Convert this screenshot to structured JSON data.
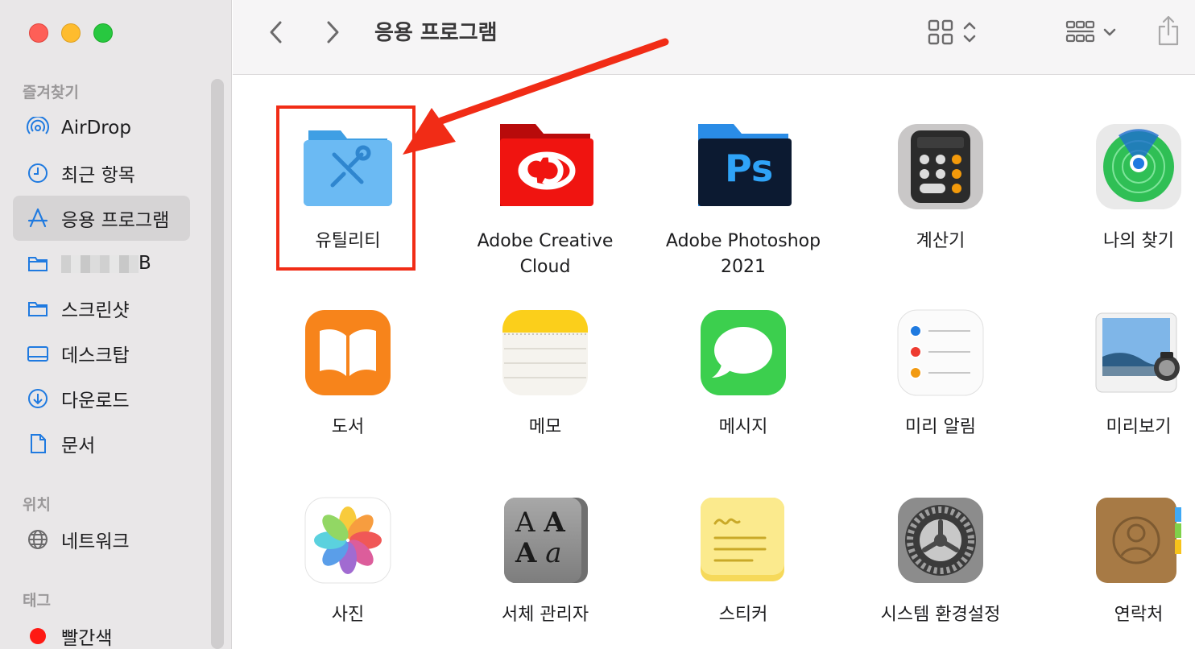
{
  "window": {
    "title": "응용 프로그램"
  },
  "sidebar": {
    "favorites_title": "즐겨찾기",
    "favorites": [
      {
        "label": "AirDrop",
        "icon": "airdrop-icon"
      },
      {
        "label": "최근 항목",
        "icon": "clock-icon"
      },
      {
        "label": "응용 프로그램",
        "icon": "applications-icon",
        "active": true
      },
      {
        "label": "B",
        "icon": "folder-icon",
        "redacted": true
      },
      {
        "label": "스크린샷",
        "icon": "folder-icon"
      },
      {
        "label": "데스크탑",
        "icon": "desktop-icon"
      },
      {
        "label": "다운로드",
        "icon": "download-icon"
      },
      {
        "label": "문서",
        "icon": "document-icon"
      }
    ],
    "locations_title": "위치",
    "locations": [
      {
        "label": "네트워크",
        "icon": "globe-icon"
      }
    ],
    "tags_title": "태그",
    "tags": [
      {
        "label": "빨간색",
        "color": "#fe1a14"
      }
    ]
  },
  "apps": [
    {
      "label": "유틸리티",
      "icon": "utilities-folder-icon"
    },
    {
      "label": "Adobe Creative\nCloud",
      "line1": "Adobe Creative",
      "line2": "Cloud",
      "icon": "creative-cloud-folder-icon"
    },
    {
      "label": "Adobe Photoshop 2021",
      "line1": "Adobe Photoshop",
      "line2": "2021",
      "icon": "photoshop-folder-icon",
      "ps_text": "Ps"
    },
    {
      "label": "계산기",
      "icon": "calculator-icon"
    },
    {
      "label": "나의 찾기",
      "icon": "find-my-icon"
    },
    {
      "label": "도서",
      "icon": "books-icon"
    },
    {
      "label": "메모",
      "icon": "notes-icon"
    },
    {
      "label": "메시지",
      "icon": "messages-icon"
    },
    {
      "label": "미리 알림",
      "icon": "reminders-icon"
    },
    {
      "label": "미리보기",
      "icon": "preview-icon"
    },
    {
      "label": "사진",
      "icon": "photos-icon"
    },
    {
      "label": "서체 관리자",
      "icon": "font-book-icon",
      "glyphs": [
        "A",
        "A",
        "A",
        "a"
      ]
    },
    {
      "label": "스티커",
      "icon": "stickies-icon"
    },
    {
      "label": "시스템 환경설정",
      "icon": "system-preferences-icon"
    },
    {
      "label": "연락처",
      "icon": "contacts-icon"
    }
  ],
  "colors": {
    "highlight": "#f12c16",
    "accent": "#1f7ae0"
  }
}
